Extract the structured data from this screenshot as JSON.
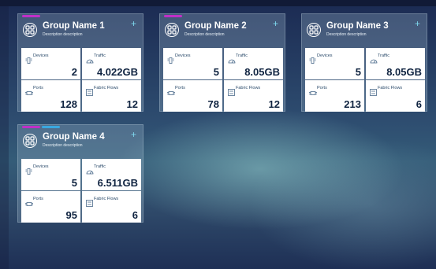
{
  "groups": [
    {
      "name": "Group Name 1",
      "description": "Description description",
      "add_label": "+",
      "stats": {
        "devices_label": "Devices",
        "devices": "2",
        "traffic_label": "Traffic",
        "traffic": "4.022GB",
        "ports_label": "Ports",
        "ports": "128",
        "flows_label": "Fabric Flows",
        "flows": "12"
      },
      "accent_colors": [
        "#c02fc8"
      ]
    },
    {
      "name": "Group Name 2",
      "description": "Description description",
      "add_label": "+",
      "stats": {
        "devices_label": "Devices",
        "devices": "5",
        "traffic_label": "Traffic",
        "traffic": "8.05GB",
        "ports_label": "Ports",
        "ports": "78",
        "flows_label": "Fabric Flows",
        "flows": "12"
      },
      "accent_colors": [
        "#c02fc8"
      ]
    },
    {
      "name": "Group Name 3",
      "description": "Description description",
      "add_label": "+",
      "stats": {
        "devices_label": "Devices",
        "devices": "5",
        "traffic_label": "Traffic",
        "traffic": "8.05GB",
        "ports_label": "Ports",
        "ports": "213",
        "flows_label": "Fabric Flows",
        "flows": "6"
      },
      "accent_colors": []
    },
    {
      "name": "Group Name 4",
      "description": "Description description",
      "add_label": "+",
      "stats": {
        "devices_label": "Devices",
        "devices": "5",
        "traffic_label": "Traffic",
        "traffic": "6.511GB",
        "ports_label": "Ports",
        "ports": "95",
        "flows_label": "Fabric Flows",
        "flows": "6"
      },
      "accent_colors": [
        "#c02fc8",
        "#3aa8e0"
      ]
    }
  ],
  "icons": {
    "group": "group-icon",
    "devices": "devices-icon",
    "traffic": "traffic-icon",
    "ports": "ports-icon",
    "flows": "fabric-flows-icon"
  }
}
